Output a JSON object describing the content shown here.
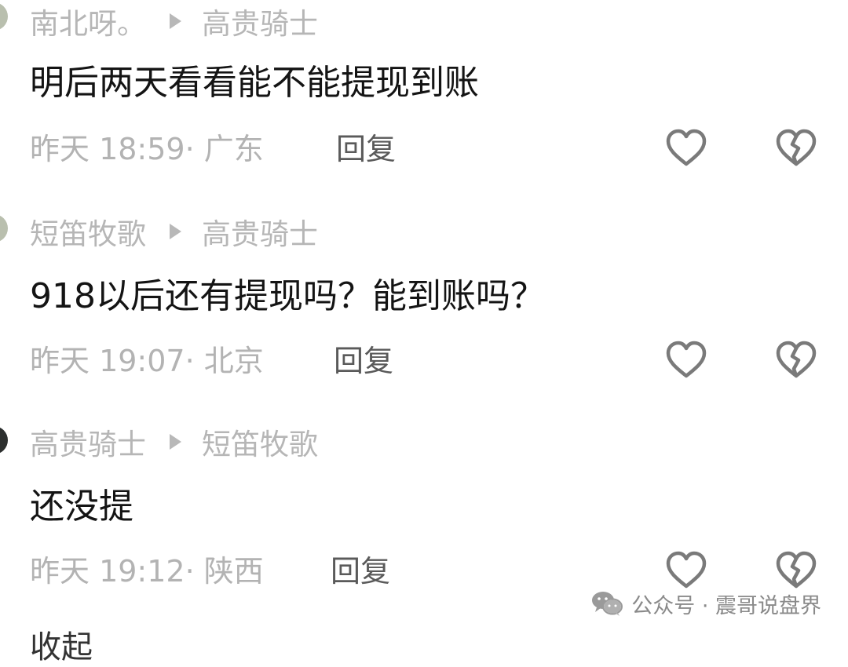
{
  "comments": [
    {
      "author": "南北呀。",
      "reply_to": "高贵骑士",
      "text": "明后两天看看能不能提现到账",
      "time": "昨天 18:59",
      "location": "广东",
      "reply_label": "回复",
      "like_icon": "heart-outline-icon",
      "dislike_icon": "broken-heart-icon"
    },
    {
      "author": "短笛牧歌",
      "reply_to": "高贵骑士",
      "text": "918以后还有提现吗？能到账吗？",
      "time": "昨天 19:07",
      "location": "北京",
      "reply_label": "回复",
      "like_icon": "heart-outline-icon",
      "dislike_icon": "broken-heart-icon"
    },
    {
      "author": "高贵骑士",
      "reply_to": "短笛牧歌",
      "text": "还没提",
      "time": "昨天 19:12",
      "location": "陕西",
      "reply_label": "回复",
      "like_icon": "heart-outline-icon",
      "dislike_icon": "broken-heart-icon"
    }
  ],
  "watermark": {
    "text": "公众号 · 震哥说盘界",
    "icon": "wechat-icon"
  },
  "collapse_label": "收起",
  "colors": {
    "meta_gray": "#b6b6b6",
    "text_dark": "#141414",
    "reply_gray": "#5a5a5a",
    "icon_gray": "#8a8a8a"
  }
}
